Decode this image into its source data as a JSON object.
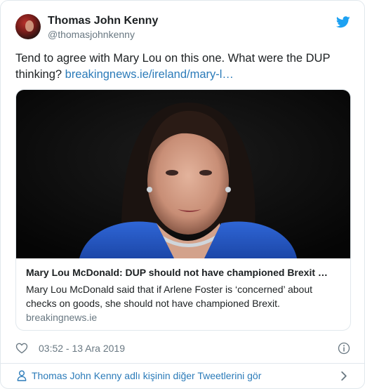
{
  "author": {
    "name": "Thomas John Kenny",
    "handle": "@thomasjohnkenny"
  },
  "tweet": {
    "text": "Tend to agree with Mary Lou on this one. What were the DUP thinking? ",
    "link": "breakingnews.ie/ireland/mary-l…"
  },
  "card": {
    "title": "Mary Lou McDonald: DUP should not have championed Brexit …",
    "description": "Mary Lou McDonald said that if Arlene Foster is ‘concerned’ about checks on goods, she should not have championed Brexit.",
    "domain": "breakingnews.ie"
  },
  "meta": {
    "timestamp": "03:52 - 13 Ara 2019"
  },
  "footer": {
    "more_tweets_label": "Thomas John Kenny adlı kişinin diğer Tweetlerini gör"
  },
  "icons": {
    "brand": "twitter-bird-icon",
    "like": "heart-icon",
    "info": "info-icon",
    "profile": "person-icon",
    "navigate": "chevron-right-icon"
  },
  "colors": {
    "link": "#2b7bb9",
    "twitter_blue": "#1da1f2",
    "muted_text": "#697882",
    "border": "#e1e8ed"
  }
}
